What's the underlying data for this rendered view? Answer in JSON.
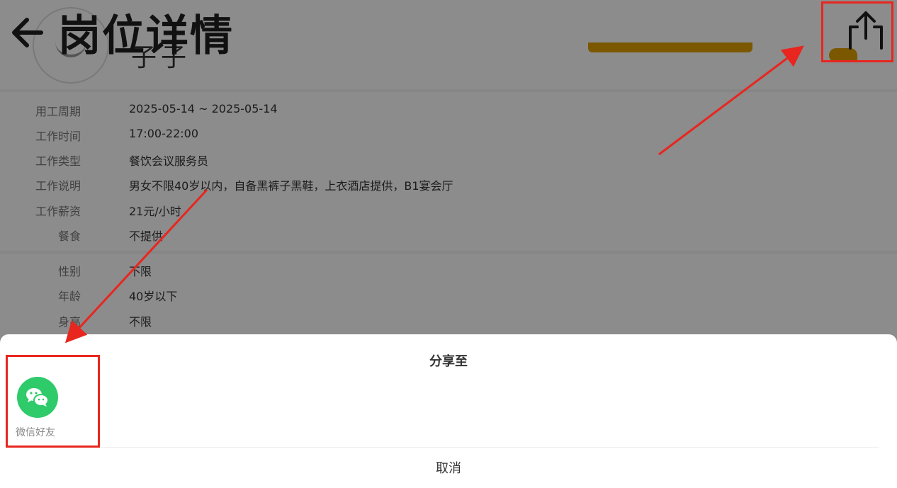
{
  "nav": {
    "title": "岗位详情"
  },
  "company": {
    "name": "子子"
  },
  "details": [
    {
      "label": "用工周期",
      "value": "2025-05-14 ~ 2025-05-14"
    },
    {
      "label": "工作时间",
      "value": "17:00-22:00"
    },
    {
      "label": "工作类型",
      "value": "餐饮会议服务员"
    },
    {
      "label": "工作说明",
      "value": "男女不限40岁以内，自备黑裤子黑鞋，上衣酒店提供，B1宴会厅"
    },
    {
      "label": "工作薪资",
      "value": "21元/小时"
    },
    {
      "label": "餐食",
      "value": "不提供"
    }
  ],
  "requirements": [
    {
      "label": "性别",
      "value": "不限"
    },
    {
      "label": "年龄",
      "value": "40岁以下"
    },
    {
      "label": "身高",
      "value": "不限"
    }
  ],
  "share_sheet": {
    "title": "分享至",
    "options": [
      {
        "label": "微信好友",
        "icon": "wechat-icon"
      }
    ],
    "cancel_label": "取消"
  },
  "colors": {
    "accent": "#e0a000",
    "wechat": "#2fcb6b",
    "annotation": "#e8261f"
  }
}
